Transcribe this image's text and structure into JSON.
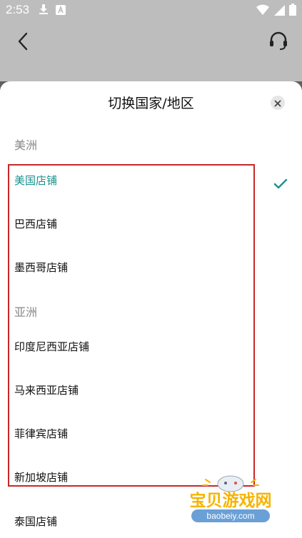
{
  "status_bar": {
    "time": "2:53",
    "left_icons": [
      "download-icon",
      "a-badge-icon"
    ],
    "right_icons": [
      "wifi-icon",
      "signal-icon",
      "battery-icon"
    ]
  },
  "app_bar": {
    "back_icon": "chevron-left-icon",
    "support_icon": "headset-icon"
  },
  "sheet": {
    "title": "切换国家/地区",
    "close_icon": "close-icon"
  },
  "sections": [
    {
      "header": "美洲",
      "items": [
        {
          "label": "美国店铺",
          "selected": true
        },
        {
          "label": "巴西店铺",
          "selected": false
        },
        {
          "label": "墨西哥店铺",
          "selected": false
        }
      ]
    },
    {
      "header": "亚洲",
      "items": [
        {
          "label": "印度尼西亚店铺",
          "selected": false
        },
        {
          "label": "马来西亚店铺",
          "selected": false
        },
        {
          "label": "菲律宾店铺",
          "selected": false
        },
        {
          "label": "新加坡店铺",
          "selected": false
        },
        {
          "label": "泰国店铺",
          "selected": false
        }
      ]
    }
  ],
  "watermark": {
    "text": "宝贝游戏网",
    "url": "baobeiy.com"
  },
  "colors": {
    "accent": "#19918c",
    "highlight_border": "#c62828"
  }
}
